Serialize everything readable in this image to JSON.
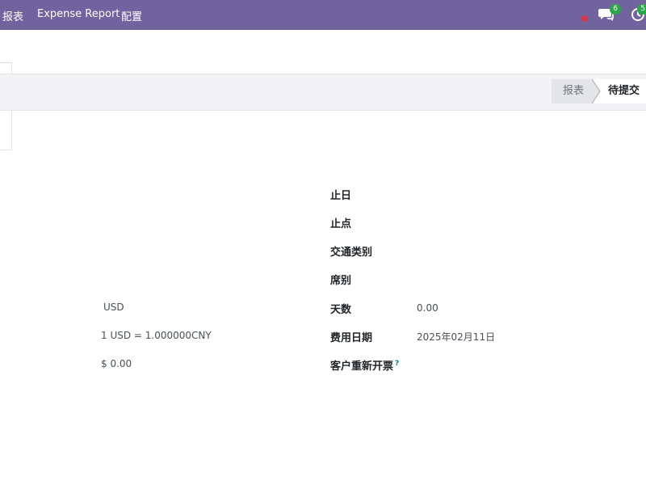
{
  "navbar": {
    "menu": [
      "报表",
      "Expense Report",
      "配置"
    ],
    "notifications": {
      "messages_count": "6",
      "activities_count": "5"
    },
    "colors": {
      "bar": "#71639e",
      "badge": "#28a745",
      "dot": "#dc3545"
    },
    "icons": [
      "red-dot-icon",
      "chat-icon",
      "clock-icon"
    ]
  },
  "statusbar": {
    "stages": [
      "报表",
      "待提交"
    ],
    "active": "待提交"
  },
  "left_column": {
    "currency": "USD",
    "exchange_rate": "1 USD = 1.000000CNY",
    "amount": "$ 0.00"
  },
  "right_column": {
    "fields": [
      {
        "label": "止日",
        "value": ""
      },
      {
        "label": "止点",
        "value": ""
      },
      {
        "label": "交通类别",
        "value": ""
      },
      {
        "label": "席别",
        "value": ""
      },
      {
        "label": "天数",
        "value": "0.00"
      },
      {
        "label": "费用日期",
        "value": "2025年02月11日"
      },
      {
        "label": "客户重新开票",
        "value": "",
        "help": "?"
      }
    ]
  }
}
